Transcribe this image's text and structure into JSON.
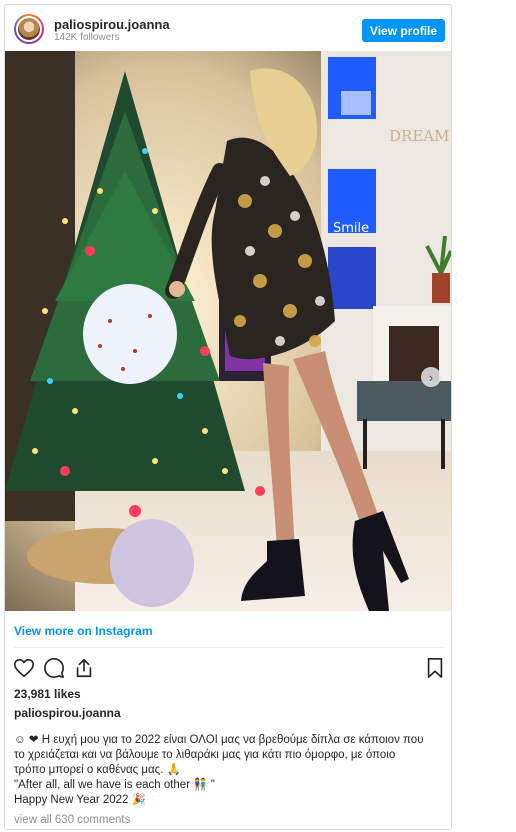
{
  "header": {
    "username": "paliospirou.joanna",
    "followers": "142K followers",
    "view_profile_label": "View profile"
  },
  "post": {
    "carousel_next_glyph": "›",
    "view_more_label": "View more on Instagram",
    "likes": "23,981 likes",
    "caption_username": "paliospirou.joanna",
    "caption_lines": [
      "☺ ❤ Η ευχή μου για το 2022 είναι ΟΛΟΙ μας να βρεθούμε δίπλα σε κάποιον που",
      "το χρειάζεται και να βάλουμε το λιθαράκι μας για κάτι πιο όμορφο, με όποιο",
      "τρόπο μπορεί ο καθένας μας. 🙏",
      "\"After all, all we have is each other 👫 \"",
      "Happy New Year 2022 🎉"
    ],
    "view_comments_label": "view all 630 comments"
  },
  "icons": {
    "like": "heart-icon",
    "comment": "comment-icon",
    "share": "share-icon",
    "save": "bookmark-icon",
    "next": "chevron-right-icon"
  },
  "photo_text": {
    "wall_sign_top": "DREAM",
    "wall_sign_mid": "Smile"
  },
  "colors": {
    "accent": "#0095f6",
    "text": "#262626",
    "muted": "#8e8e8e",
    "border": "#dbdbdb"
  }
}
